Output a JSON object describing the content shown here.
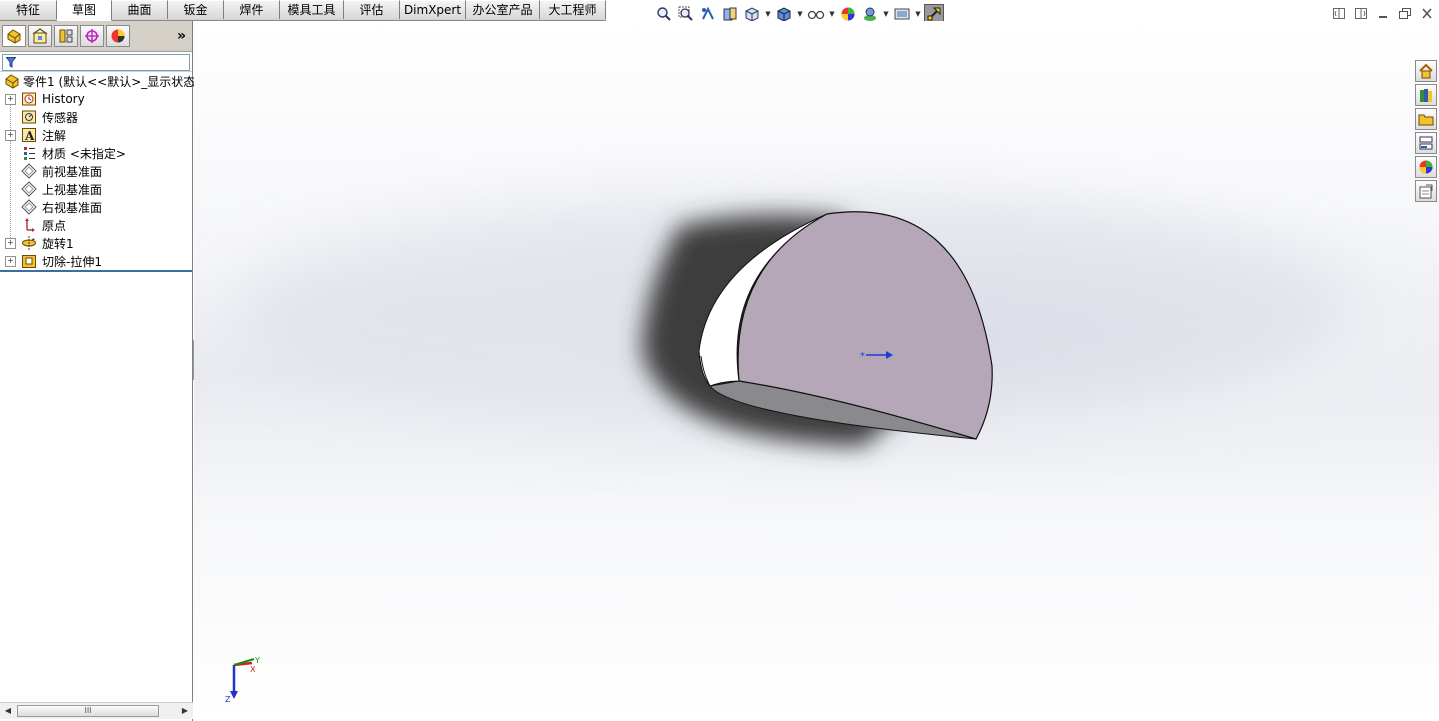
{
  "command_tabs": [
    "特征",
    "草图",
    "曲面",
    "钣金",
    "焊件",
    "模具工具",
    "评估",
    "DimXpert",
    "办公室产品",
    "大工程师"
  ],
  "active_tab": "草图",
  "tree": {
    "root": "零件1  (默认<<默认>_显示状态",
    "items": [
      {
        "label": "History",
        "icon": "history-icon",
        "expandable": true
      },
      {
        "label": "传感器",
        "icon": "sensor-icon",
        "expandable": false
      },
      {
        "label": "注解",
        "icon": "annotation-icon",
        "expandable": true
      },
      {
        "label": "材质 <未指定>",
        "icon": "material-icon",
        "expandable": false
      },
      {
        "label": "前视基准面",
        "icon": "plane-icon",
        "expandable": false
      },
      {
        "label": "上视基准面",
        "icon": "plane-icon",
        "expandable": false
      },
      {
        "label": "右视基准面",
        "icon": "plane-icon",
        "expandable": false
      },
      {
        "label": "原点",
        "icon": "origin-icon",
        "expandable": false
      },
      {
        "label": "旋转1",
        "icon": "revolve-icon",
        "expandable": true
      },
      {
        "label": "切除-拉伸1",
        "icon": "cut-extrude-icon",
        "expandable": true
      }
    ]
  },
  "panel_more": "»",
  "scroll_grip": "III",
  "triad": {
    "x": "X",
    "y": "Y",
    "z": "Z"
  },
  "colors": {
    "model_face": "#b5a7b7",
    "model_side": "#ffffff",
    "model_bottom": "#8a8a8e",
    "shadow": "#3c3c3e",
    "selection_blue": "#3a6ea5"
  }
}
